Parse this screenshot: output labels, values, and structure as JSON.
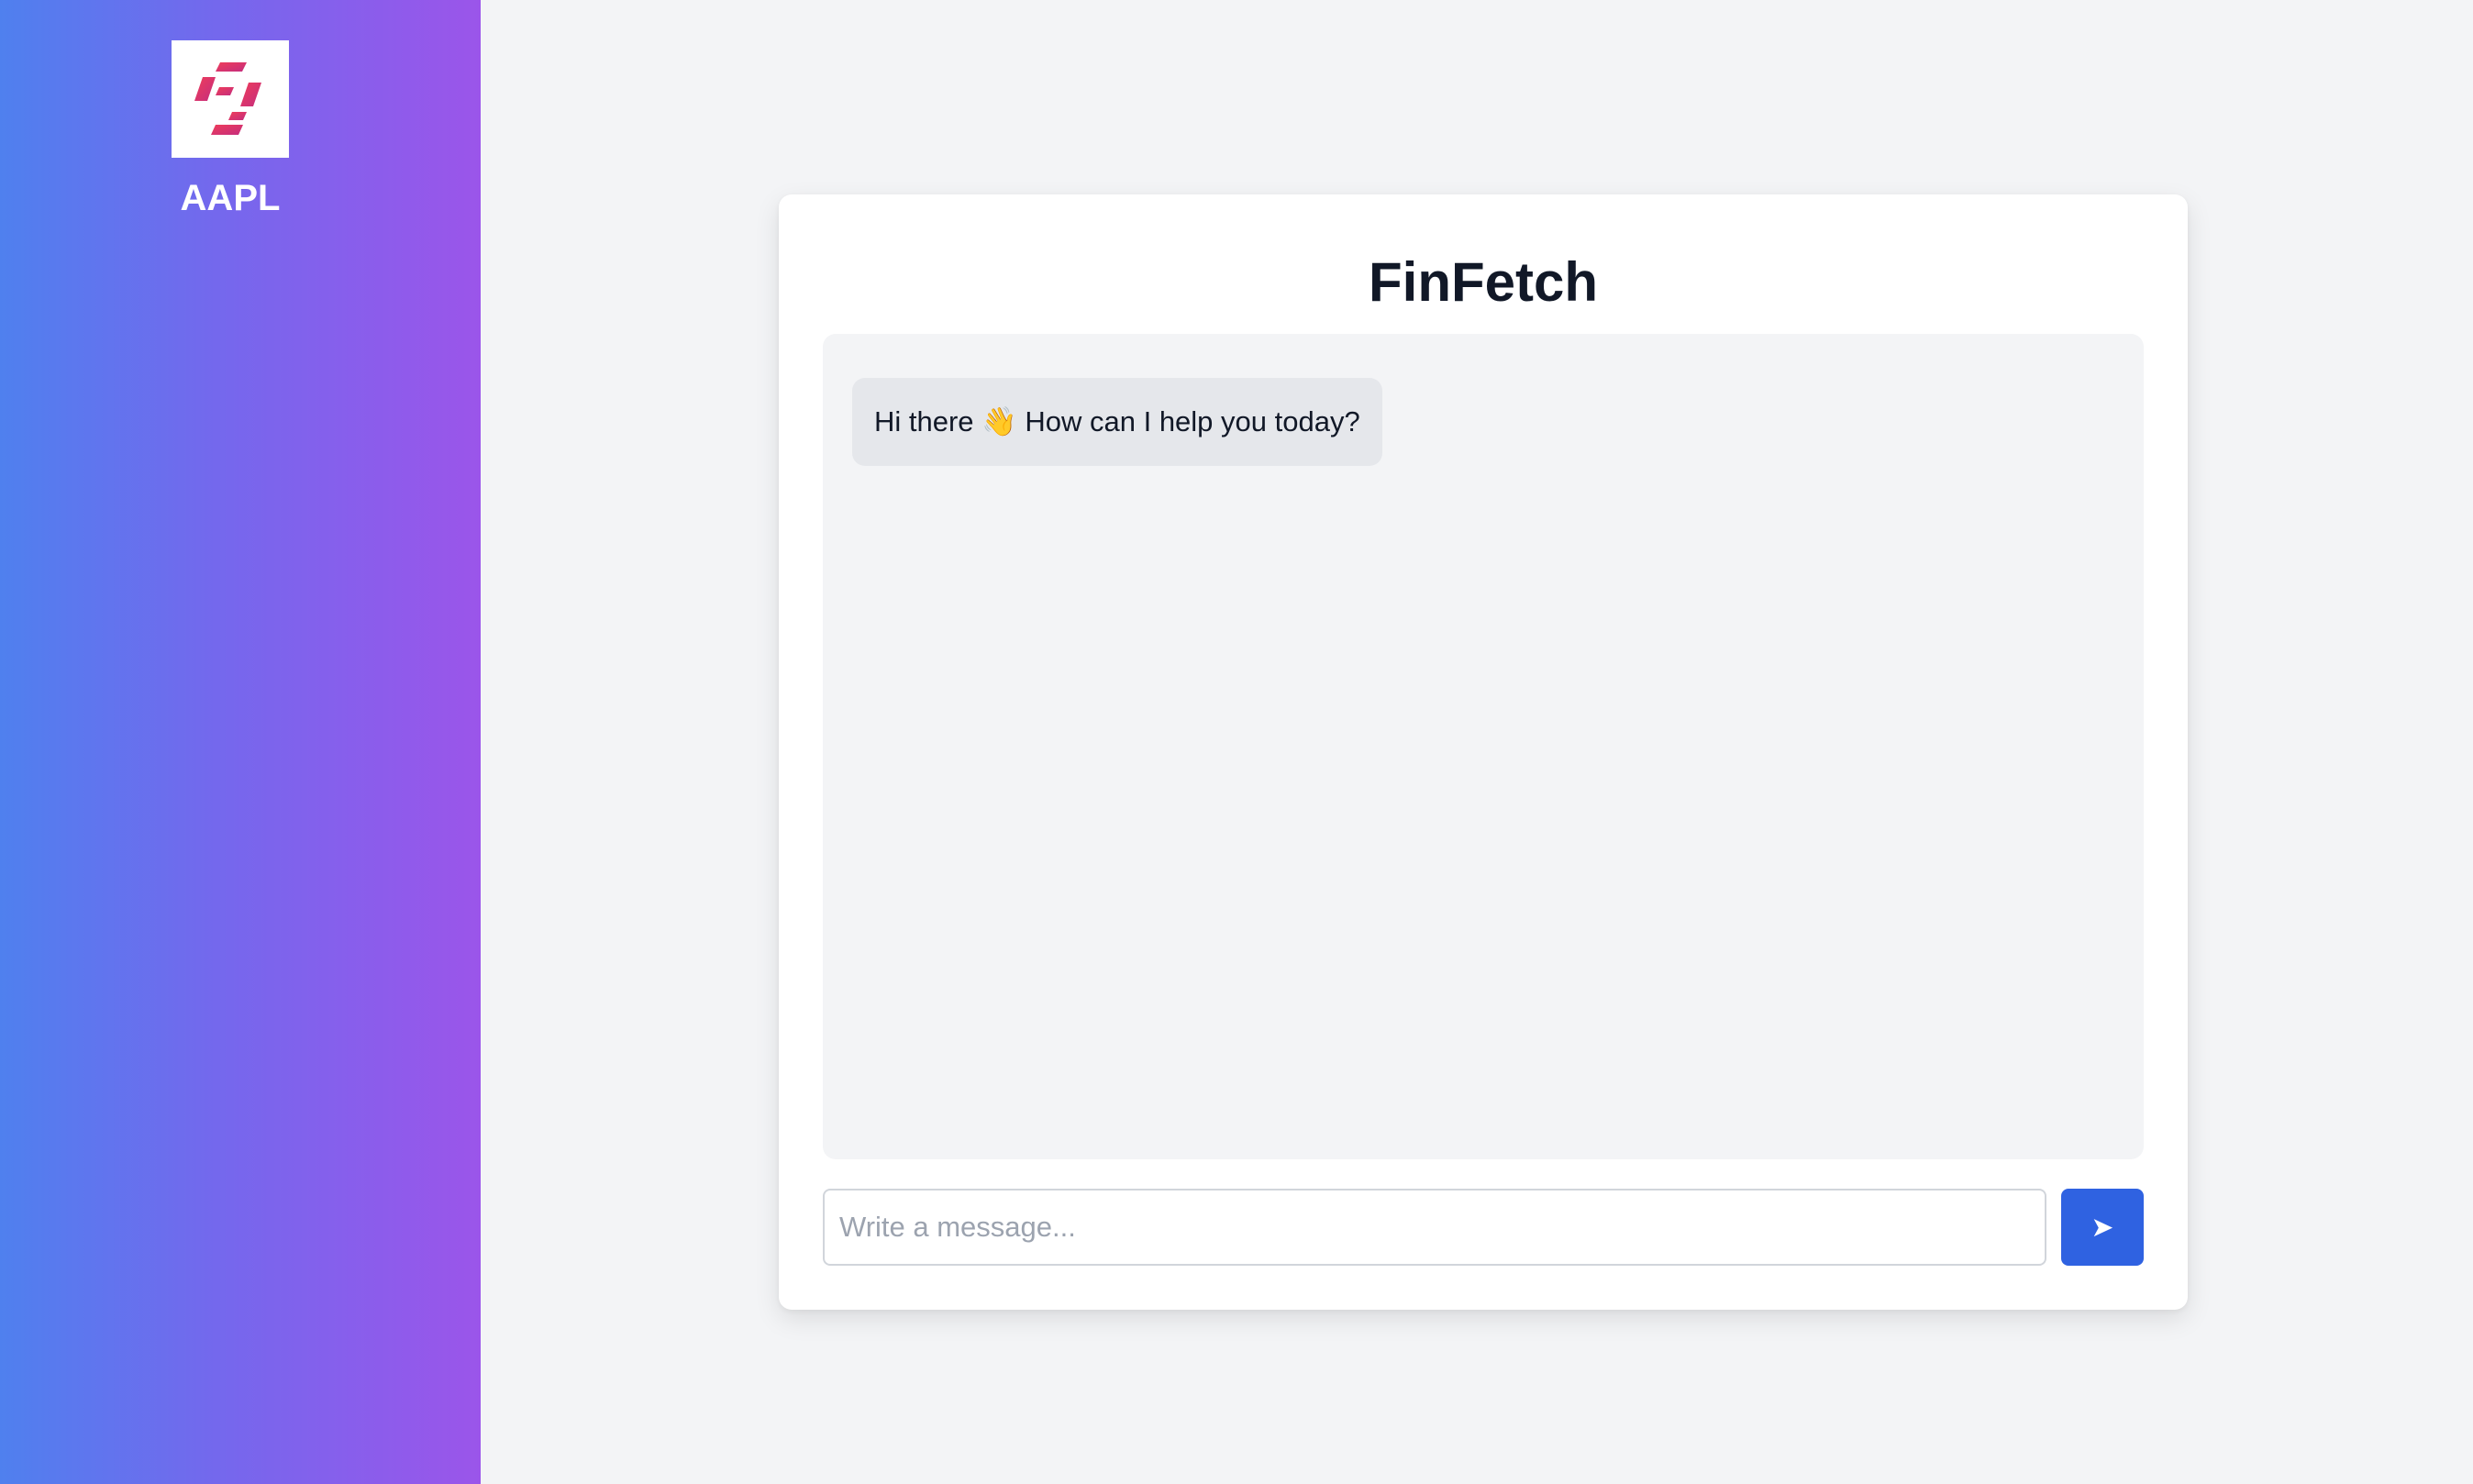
{
  "sidebar": {
    "logo_icon": "finfetch-logo-icon",
    "ticker": "AAPL",
    "gradient_start": "#4f80ee",
    "gradient_end": "#9b55ea"
  },
  "chat": {
    "title": "FinFetch",
    "messages": [
      {
        "sender": "bot",
        "text": "Hi there 👋 How can I help you today?"
      }
    ],
    "input": {
      "value": "",
      "placeholder": "Write a message..."
    },
    "send_button": {
      "icon": "send-arrow-icon",
      "glyph": "➤",
      "color": "#2f62e1"
    }
  }
}
